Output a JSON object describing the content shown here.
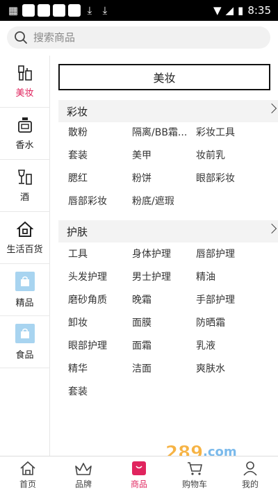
{
  "status": {
    "time": "8:35"
  },
  "search": {
    "placeholder": "搜索商品"
  },
  "sidebar": {
    "items": [
      {
        "label": "美妆",
        "icon": "makeup-icon"
      },
      {
        "label": "香水",
        "icon": "perfume-icon"
      },
      {
        "label": "酒",
        "icon": "wine-icon"
      },
      {
        "label": "生活百货",
        "icon": "home-icon"
      },
      {
        "label": "精品",
        "icon": "bag-icon"
      },
      {
        "label": "食品",
        "icon": "bag-icon"
      }
    ],
    "active": "美妆"
  },
  "main": {
    "section_title": "美妆",
    "categories": [
      {
        "title": "彩妆",
        "items": [
          "散粉",
          "隔离/BB霜...",
          "彩妆工具",
          "套装",
          "美甲",
          "妆前乳",
          "腮红",
          "粉饼",
          "眼部彩妆",
          "唇部彩妆",
          "粉底/遮瑕"
        ]
      },
      {
        "title": "护肤",
        "items": [
          "工具",
          "身体护理",
          "唇部护理",
          "头发护理",
          "男士护理",
          "精油",
          "磨砂角质",
          "晚霜",
          "手部护理",
          "卸妆",
          "面膜",
          "防晒霜",
          "眼部护理",
          "面霜",
          "乳液",
          "精华",
          "洁面",
          "爽肤水",
          "套装"
        ]
      }
    ]
  },
  "bottom_nav": {
    "items": [
      {
        "label": "首页",
        "icon": "home-icon"
      },
      {
        "label": "品牌",
        "icon": "crown-icon"
      },
      {
        "label": "商品",
        "icon": "bag-icon"
      },
      {
        "label": "购物车",
        "icon": "cart-icon"
      },
      {
        "label": "我的",
        "icon": "user-icon"
      }
    ],
    "active": "商品"
  },
  "watermark": {
    "text": "289.com 手游网"
  },
  "colors": {
    "accent": "#e0245e",
    "tile": "#a8d4f0",
    "header_bg": "#f3f3f3"
  }
}
